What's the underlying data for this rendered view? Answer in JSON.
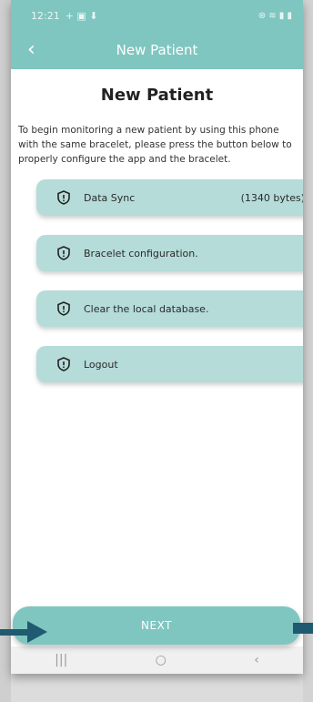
{
  "status_bar": {
    "time": "12:21",
    "left_icons": "+ ▣ ⬇",
    "right_icons": "⊛ ≋ ▮ ▮"
  },
  "app_bar": {
    "back_label": "‹",
    "title": "New Patient"
  },
  "page": {
    "heading": "New Patient",
    "intro": "To begin monitoring a new patient by using this phone with the same bracelet, please press the button below to properly configure the app and the bracelet."
  },
  "options": [
    {
      "label": "Data Sync",
      "extra": "(1340 bytes)",
      "icon": "shield-alert-icon"
    },
    {
      "label": "Bracelet configuration.",
      "extra": "",
      "icon": "shield-alert-icon"
    },
    {
      "label": "Clear the local database.",
      "extra": "",
      "icon": "shield-alert-icon"
    },
    {
      "label": "Logout",
      "extra": "",
      "icon": "shield-alert-icon"
    }
  ],
  "next_button": {
    "label": "NEXT"
  },
  "nav_bar": {
    "recents": "|||",
    "home": "○",
    "back": "‹"
  },
  "colors": {
    "accent": "#7fc6c0",
    "option_bg": "#b5dcd9",
    "arrow": "#1f5a70"
  }
}
